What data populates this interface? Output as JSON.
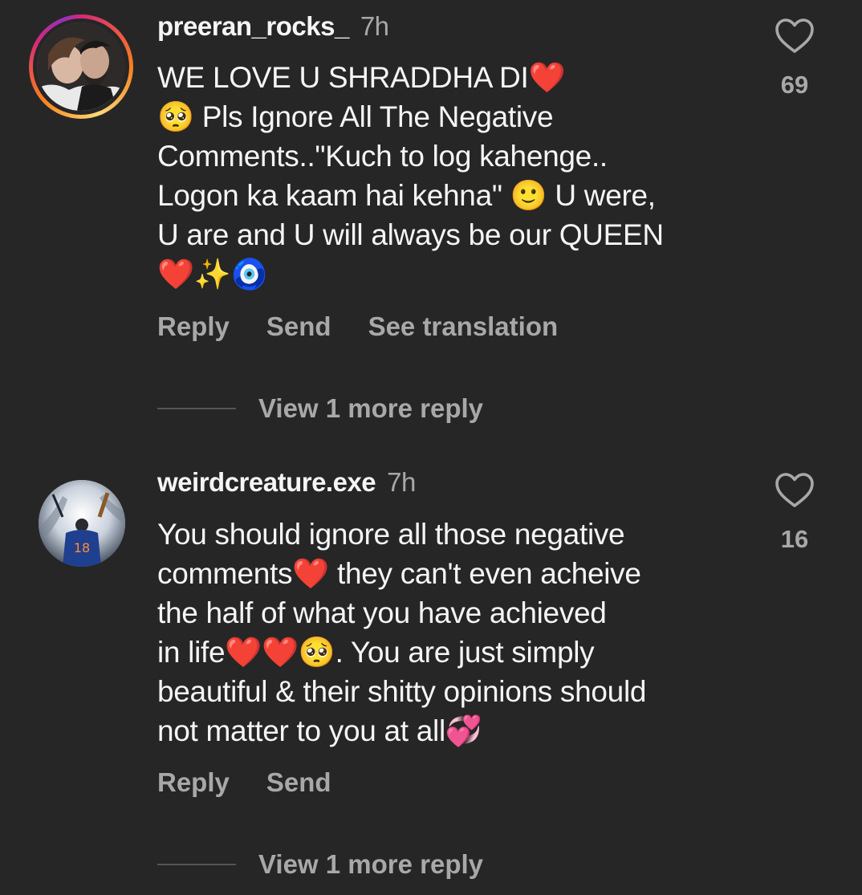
{
  "comments": [
    {
      "username": "preeran_rocks_",
      "time": "7h",
      "lines": [
        "WE LOVE U SHRADDHA DI❤️",
        "🥺 Pls Ignore All The Negative",
        "Comments..\"Kuch to log kahenge..",
        "Logon ka kaam hai kehna\" 🙂 U were,",
        "U are and U will always be our QUEEN",
        "❤️✨🧿"
      ],
      "actions": [
        "Reply",
        "Send",
        "See translation"
      ],
      "like_icon": "heart-outline-icon",
      "likes": "69",
      "more_replies": "View 1 more reply"
    },
    {
      "username": "weirdcreature.exe",
      "time": "7h",
      "lines": [
        "You should ignore all those negative",
        "comments❤️ they can't even acheive",
        "the half of what you have achieved",
        "in life❤️❤️🥺. You are just simply",
        "beautiful & their shitty opinions should",
        "not matter to you at all💞"
      ],
      "actions": [
        "Reply",
        "Send"
      ],
      "like_icon": "heart-outline-icon",
      "likes": "16",
      "more_replies": "View 1 more reply"
    }
  ],
  "colors": {
    "background": "#262626",
    "primary_text": "#f5f5f5",
    "secondary_text": "#a8a8a8"
  }
}
